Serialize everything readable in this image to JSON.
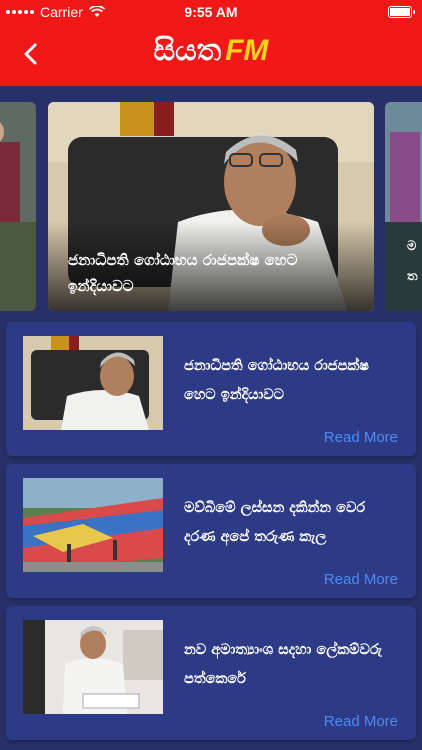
{
  "status_bar": {
    "carrier": "Carrier",
    "time": "9:55 AM"
  },
  "header": {
    "title_si": "සියත",
    "title_fm": "FM"
  },
  "carousel": {
    "main_caption": "ජනාධිපති ගෝඨාභය රාජපක්ෂ හෙට ඉන්දියාවට",
    "right_peek": "ම\nත"
  },
  "news": [
    {
      "title": "ජනාධිපති ගෝඨාභය රාජපක්ෂ හෙට ඉන්දියාවට",
      "read_more": "Read More"
    },
    {
      "title": "මව්බිමේ ලස්සන දකින්න වෙර දරණ අපේ තරුණ කැල",
      "read_more": "Read More"
    },
    {
      "title": "නව අමාත්‍යාංශ සදහා ලේකම්වරු පත්කෙරේ",
      "read_more": "Read More"
    }
  ],
  "colors": {
    "header_red": "#f21818",
    "fm_yellow": "#ffd31a",
    "card_bg": "#2d3a86",
    "page_bg": "#28306a",
    "link_blue": "#4d8bf0"
  }
}
